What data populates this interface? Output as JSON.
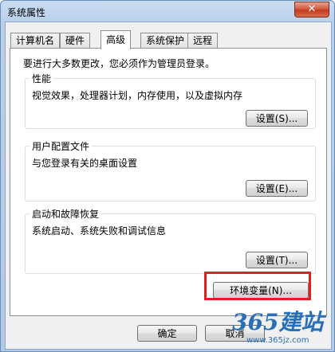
{
  "window": {
    "title": "系统属性",
    "close_glyph": "✕"
  },
  "tabs": [
    {
      "label": "计算机名",
      "active": false
    },
    {
      "label": "硬件",
      "active": false
    },
    {
      "label": "高级",
      "active": true
    },
    {
      "label": "系统保护",
      "active": false
    },
    {
      "label": "远程",
      "active": false
    }
  ],
  "notice": "要进行大多数更改，您必须作为管理员登录。",
  "groups": {
    "performance": {
      "title": "性能",
      "desc": "视觉效果，处理器计划，内存使用，以及虚拟内存",
      "button": "设置(S)..."
    },
    "user_profiles": {
      "title": "用户配置文件",
      "desc": "与您登录有关的桌面设置",
      "button": "设置(E)..."
    },
    "startup": {
      "title": "启动和故障恢复",
      "desc": "系统启动、系统失败和调试信息",
      "button": "设置(T)..."
    }
  },
  "env_button": "环境变量(N)...",
  "footer": {
    "ok": "确定",
    "cancel": "取消"
  },
  "watermark": {
    "logo_text": "365建站",
    "url": "www.365jz.com"
  }
}
